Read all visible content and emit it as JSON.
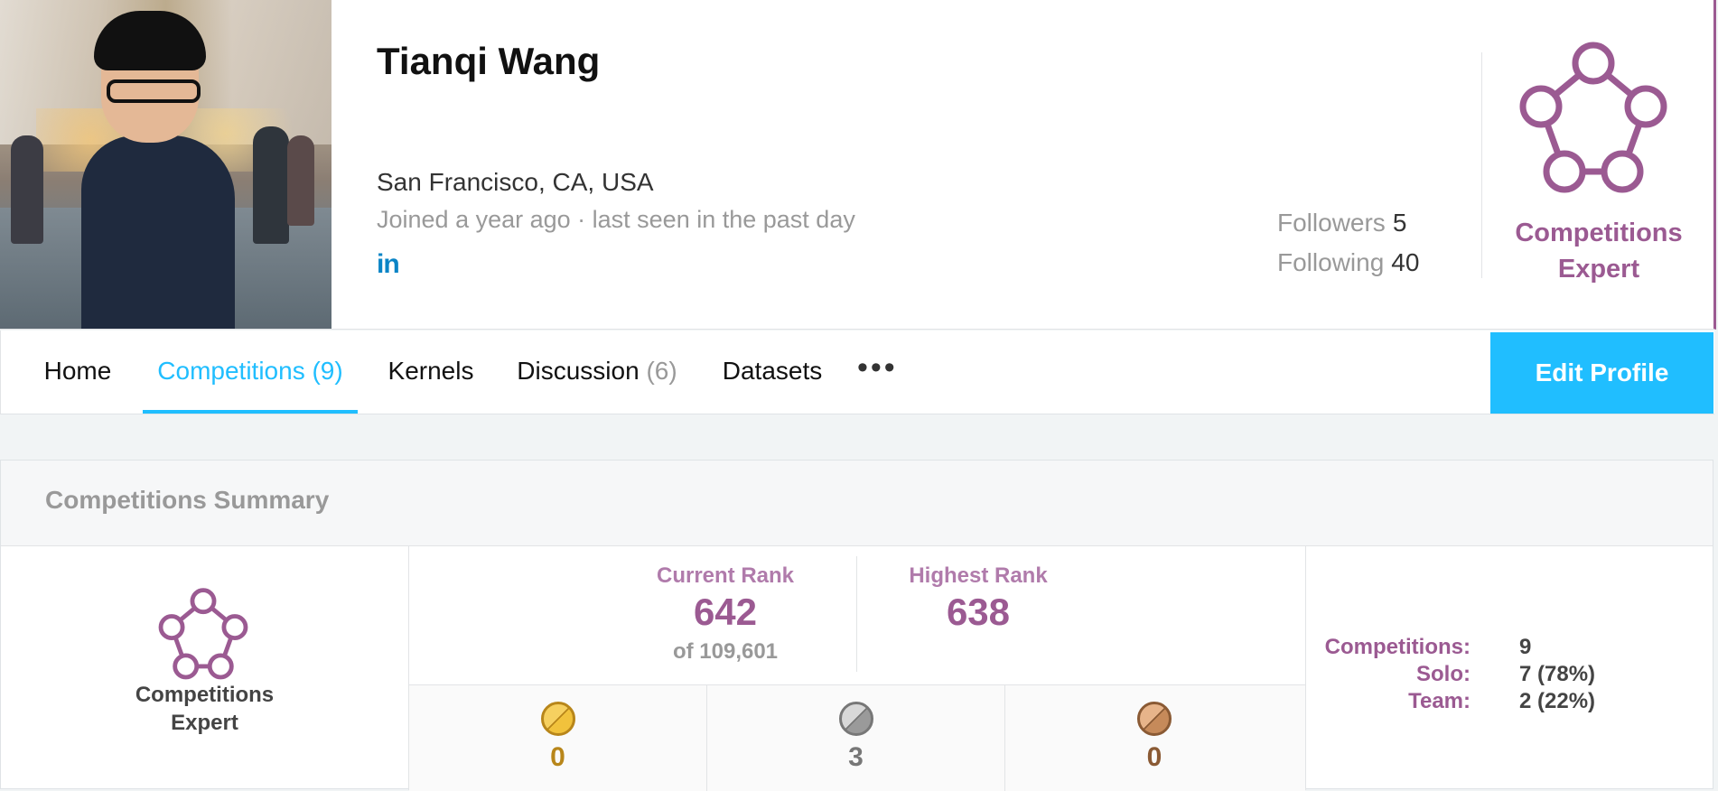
{
  "profile": {
    "name": "Tianqi Wang",
    "location": "San Francisco, CA, USA",
    "joined": "Joined a year ago · last seen in the past day",
    "social": {
      "linkedin_glyph": "in",
      "linkedin_color": "#0a84c6"
    },
    "followers_label": "Followers",
    "followers_count": "5",
    "following_label": "Following",
    "following_count": "40",
    "tier": {
      "line1": "Competitions",
      "line2": "Expert",
      "color": "#9b5a92",
      "icon": "expert-pentagon-icon"
    }
  },
  "nav": {
    "tabs": [
      {
        "label": "Home",
        "count": ""
      },
      {
        "label": "Competitions",
        "count": "(9)",
        "active": true
      },
      {
        "label": "Kernels",
        "count": ""
      },
      {
        "label": "Discussion",
        "count": "(6)"
      },
      {
        "label": "Datasets",
        "count": ""
      }
    ],
    "more_glyph": "•••",
    "edit_profile_label": "Edit Profile",
    "accent_color": "#20beff"
  },
  "summary": {
    "title": "Competitions Summary",
    "tier": {
      "line1": "Competitions",
      "line2": "Expert"
    },
    "current_rank_label": "Current Rank",
    "current_rank_value": "642",
    "current_rank_of": "of 109,601",
    "highest_rank_label": "Highest Rank",
    "highest_rank_value": "638",
    "medals": [
      {
        "type": "gold",
        "count": "0",
        "color": "#f1c23c",
        "text_color": "#b8861a"
      },
      {
        "type": "silver",
        "count": "3",
        "color": "#9a9a9a",
        "text_color": "#777777"
      },
      {
        "type": "bronze",
        "count": "0",
        "color": "#c68a5a",
        "text_color": "#8a5a34"
      }
    ],
    "stats": [
      {
        "label": "Competitions:",
        "value": "9"
      },
      {
        "label": "Solo:",
        "value": "7 (78%)"
      },
      {
        "label": "Team:",
        "value": "2 (22%)"
      }
    ]
  }
}
